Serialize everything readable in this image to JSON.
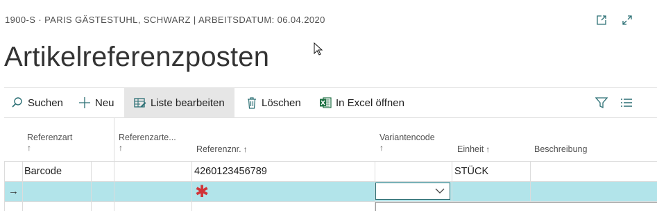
{
  "header": {
    "caption": "1900-S · PARIS GÄSTESTUHL, SCHWARZ | ARBEITSDATUM: 06.04.2020",
    "title": "Artikelreferenzposten"
  },
  "window_icons": [
    "open-in-new-window-icon",
    "expand-icon"
  ],
  "actions": [
    {
      "label": "Suchen",
      "icon": "search-icon"
    },
    {
      "label": "Neu",
      "icon": "plus-icon"
    },
    {
      "label": "Liste bearbeiten",
      "icon": "edit-list-icon",
      "active": true
    },
    {
      "label": "Löschen",
      "icon": "trash-icon"
    },
    {
      "label": "In Excel öffnen",
      "icon": "excel-icon"
    }
  ],
  "toolbar_right_icons": [
    "filter-icon",
    "list-view-icon"
  ],
  "columns": {
    "referenzart": {
      "label": "Referenzart",
      "sort": "↑"
    },
    "referenzart_nr": {
      "label": "Referenzarte...",
      "sort": "↑"
    },
    "referenznr": {
      "label": "Referenznr.",
      "sort": "↑"
    },
    "variantencode": {
      "label": "Variantencode",
      "sort": "↑"
    },
    "einheit": {
      "label": "Einheit",
      "sort": "↑"
    },
    "beschreibung": {
      "label": "Beschreibung"
    }
  },
  "rows": [
    {
      "referenzart": "Barcode",
      "referenzart_nr": "",
      "referenznr": "4260123456789",
      "variantencode": "",
      "einheit": "STÜCK",
      "beschreibung": ""
    }
  ],
  "new_row": {
    "indicator": "→",
    "required_marker": "✱",
    "variantencode_value": ""
  },
  "colors": {
    "new_row_background": "#b2e4ea",
    "accent": "#2b6f74",
    "required": "#d13438"
  }
}
